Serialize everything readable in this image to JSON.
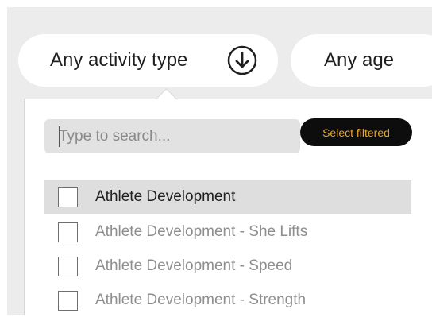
{
  "filters": {
    "activity_label": "Any activity type",
    "activity_icon": "arrow-down-circle-icon",
    "age_label": "Any age"
  },
  "dropdown": {
    "search_placeholder": "Type to search...",
    "select_filtered_label": "Select filtered",
    "options": [
      {
        "label": "Athlete Development",
        "checked": false,
        "highlighted": true
      },
      {
        "label": "Athlete Development - She Lifts",
        "checked": false
      },
      {
        "label": "Athlete Development - Speed",
        "checked": false
      },
      {
        "label": "Athlete Development - Strength",
        "checked": false
      }
    ]
  },
  "colors": {
    "background": "#ececec",
    "pill": "#ffffff",
    "button_bg": "#0d0d0d",
    "button_text": "#e6a72a",
    "highlight_row": "#dedede"
  }
}
